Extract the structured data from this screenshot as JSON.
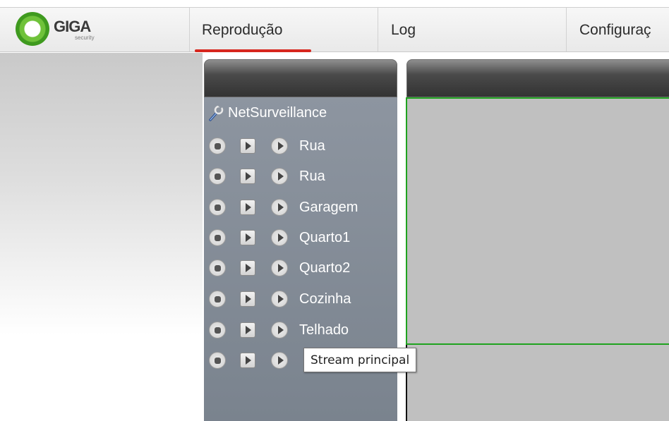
{
  "brand": {
    "logo_text": "GIGA",
    "logo_sub": "security",
    "accent_color": "#d7261e",
    "logo_color": "#5db22e"
  },
  "nav": {
    "items": [
      {
        "label": "Reprodução",
        "active": true
      },
      {
        "label": "Log",
        "active": false
      },
      {
        "label": "Configuraç",
        "active": false
      }
    ]
  },
  "device_tree": {
    "root_label": "NetSurveillance",
    "root_icon": "wrench-icon",
    "cameras": [
      {
        "label": "Rua"
      },
      {
        "label": "Rua"
      },
      {
        "label": "Garagem"
      },
      {
        "label": "Quarto1"
      },
      {
        "label": "Quarto2"
      },
      {
        "label": "Cozinha"
      },
      {
        "label": "Telhado"
      },
      {
        "label": ""
      }
    ],
    "row_icons": [
      "stop-icon",
      "play-square-icon",
      "play-round-icon"
    ]
  },
  "tooltip": {
    "text": "Stream principal"
  },
  "video": {
    "selected_border_color": "#1fa31f"
  }
}
